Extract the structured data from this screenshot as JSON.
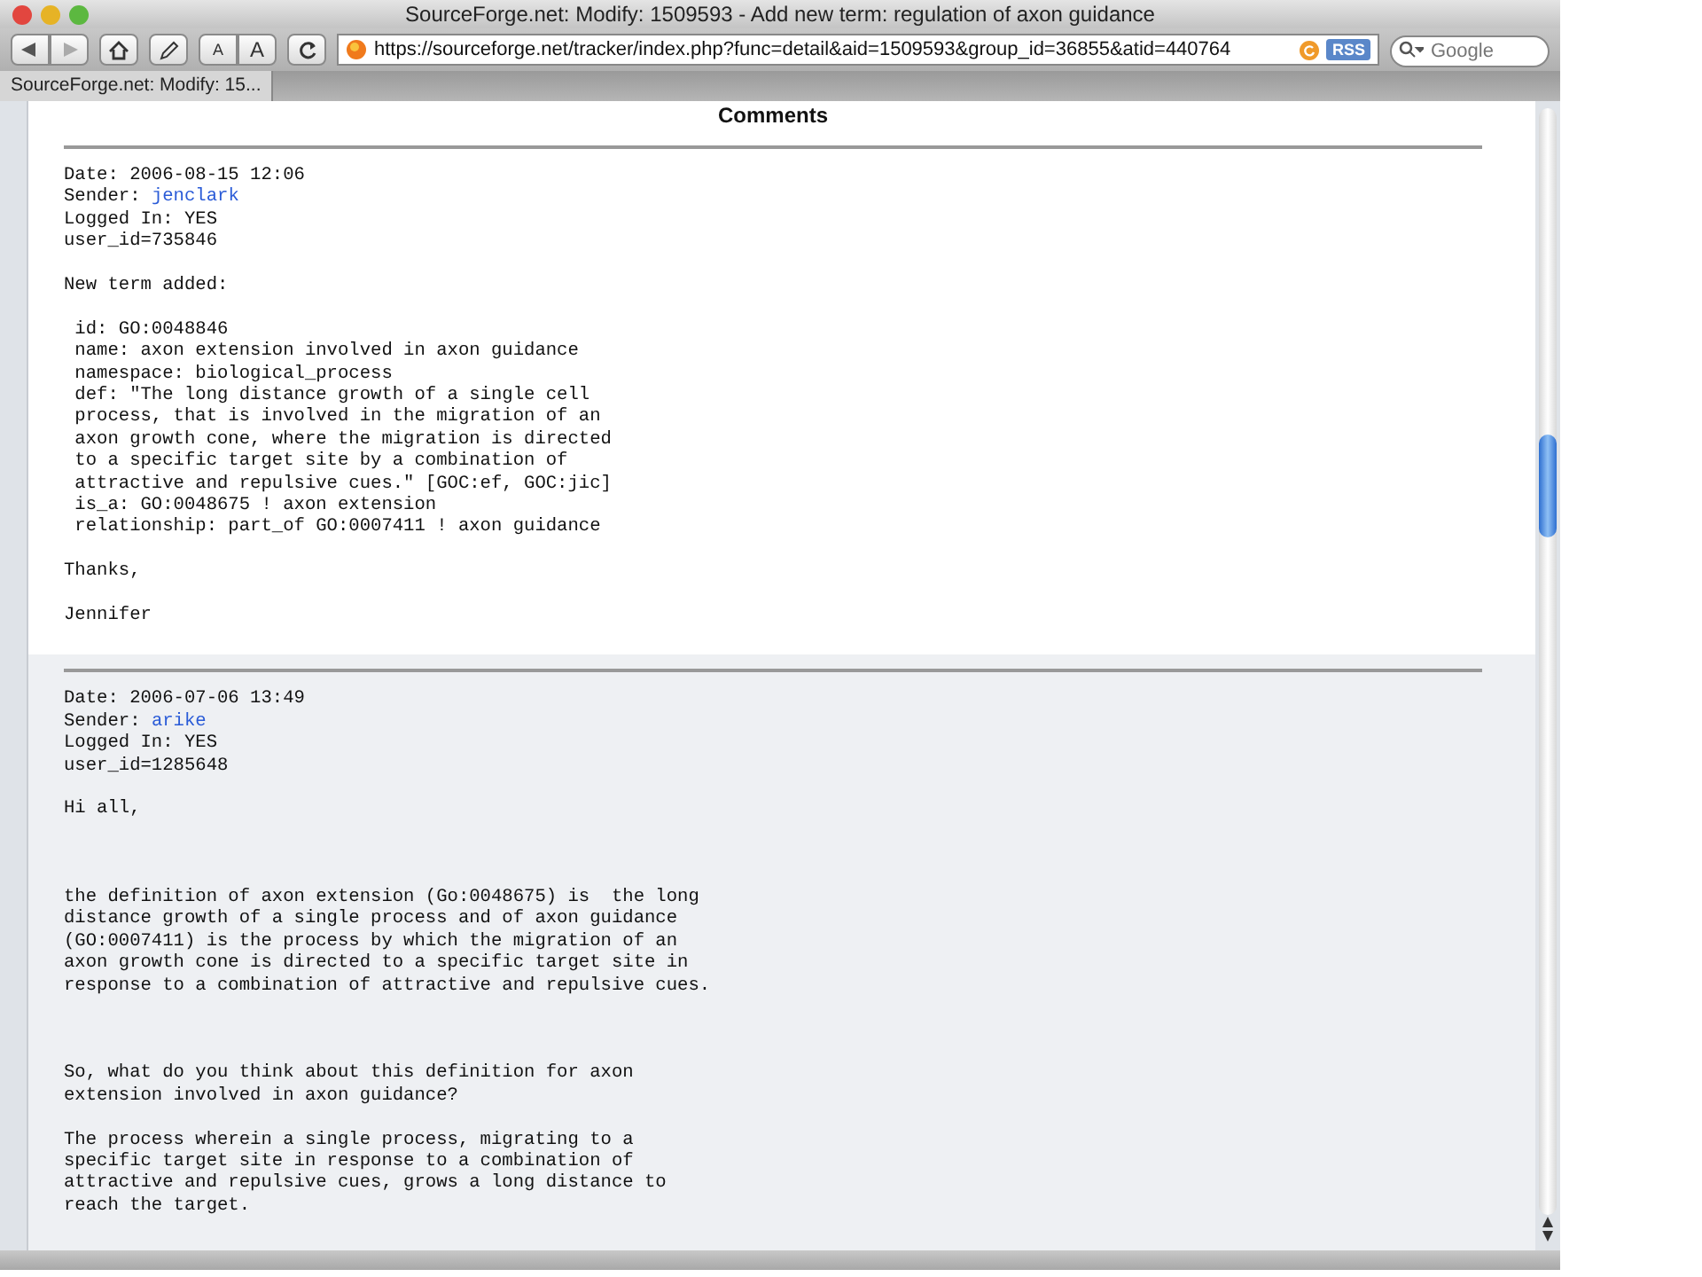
{
  "window": {
    "title": "SourceForge.net: Modify: 1509593 - Add new term: regulation of axon guidance"
  },
  "toolbar": {
    "text_size_buttons": [
      "A",
      "A"
    ],
    "url": "https://sourceforge.net/tracker/index.php?func=detail&aid=1509593&group_id=36855&atid=440764",
    "feed_badge": "RSS",
    "search": {
      "placeholder": "Google"
    }
  },
  "tabs": [
    {
      "label": "SourceForge.net: Modify: 15...",
      "selected": true
    }
  ],
  "page": {
    "heading": "Comments",
    "comments": [
      {
        "date": "Date: 2006-08-15 12:06",
        "sender_label": "Sender:",
        "sender": "jenclark",
        "logged_in": "Logged In: YES",
        "user_id": "user_id=735846",
        "highlighted": false,
        "paragraphs": [
          {
            "kind": "normal",
            "text": "New term added:"
          },
          {
            "kind": "normal",
            "text": " id: GO:0048846\n name: axon extension involved in axon guidance\n namespace: biological_process\n def: \"The long distance growth of a single cell\n process, that is involved in the migration of an\n axon growth cone, where the migration is directed\n to a specific target site by a combination of\n attractive and repulsive cues.\" [GOC:ef, GOC:jic]\n is_a: GO:0048675 ! axon extension\n relationship: part_of GO:0007411 ! axon guidance"
          },
          {
            "kind": "normal",
            "text": "Thanks,"
          },
          {
            "kind": "normal",
            "text": "Jennifer"
          }
        ]
      },
      {
        "date": "Date: 2006-07-06 13:49",
        "sender_label": "Sender:",
        "sender": "arike",
        "logged_in": "Logged In: YES",
        "user_id": "user_id=1285648",
        "highlighted": true,
        "paragraphs": [
          {
            "kind": "normal",
            "text": "Hi all,"
          },
          {
            "kind": "spaced",
            "text": "the definition of axon extension (Go:0048675) is  the long\ndistance growth of a single process and of axon guidance\n(GO:0007411) is the process by which the migration of an\naxon growth cone is directed to a specific target site in\nresponse to a combination of attractive and repulsive cues."
          },
          {
            "kind": "spaced",
            "text": "So, what do you think about this definition for axon\nextension involved in axon guidance?"
          },
          {
            "kind": "normal",
            "text": "The process wherein a single process, migrating to a\nspecific target site in response to a combination of\nattractive and repulsive cues, grows a long distance to\nreach the target."
          }
        ]
      }
    ]
  }
}
